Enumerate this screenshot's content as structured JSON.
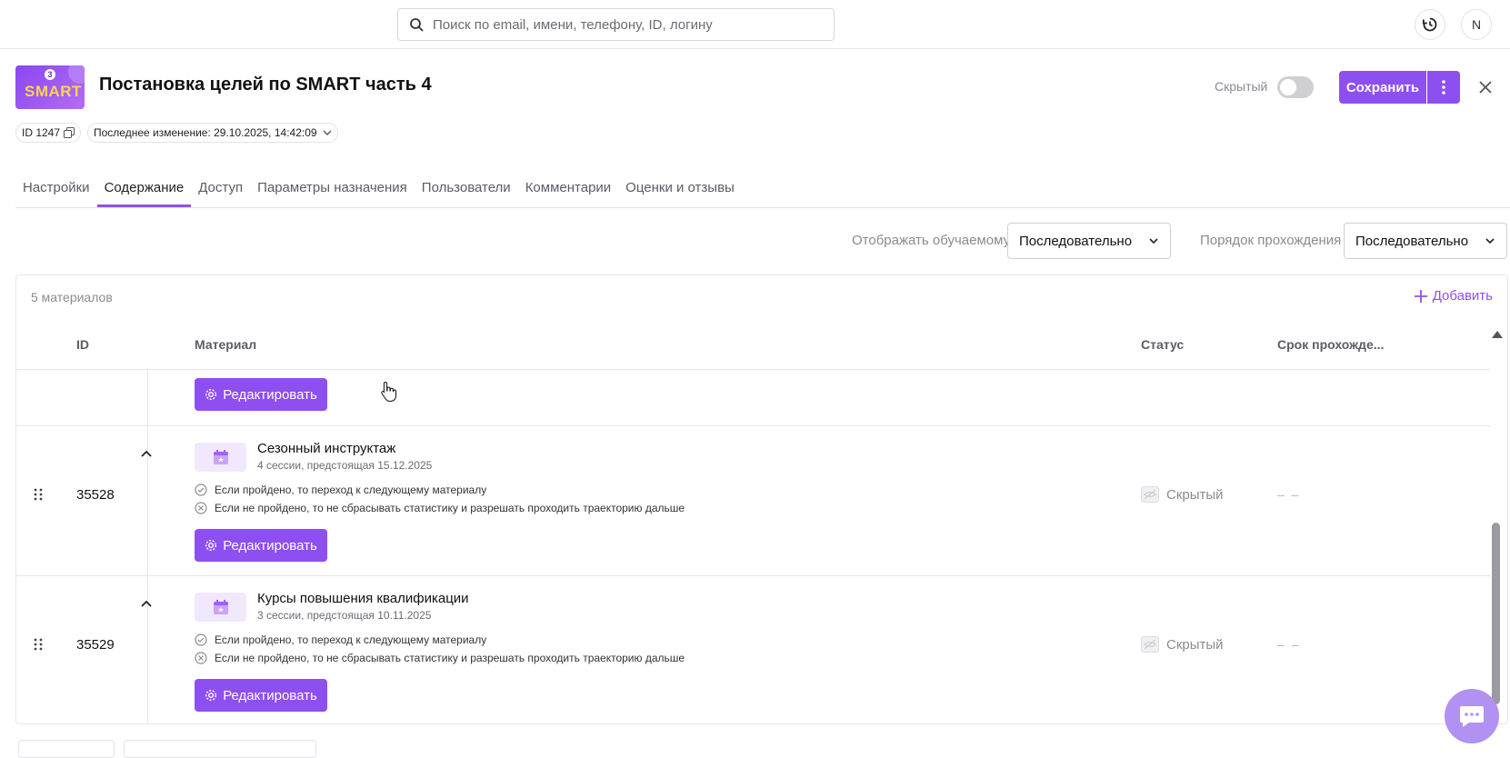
{
  "topbar": {
    "search_placeholder": "Поиск по email, имени, телефону, ID, логину",
    "avatar_initial": "N"
  },
  "header": {
    "logo_text": "SMART",
    "logo_badge": "3",
    "title": "Постановка целей по SMART часть 4",
    "hidden_label": "Скрытый",
    "save_label": "Сохранить",
    "id_chip": "ID 1247",
    "last_change": "Последнее изменение: 29.10.2025, 14:42:09"
  },
  "tabs": [
    {
      "label": "Настройки"
    },
    {
      "label": "Содержание"
    },
    {
      "label": "Доступ"
    },
    {
      "label": "Параметры назначения"
    },
    {
      "label": "Пользователи"
    },
    {
      "label": "Комментарии"
    },
    {
      "label": "Оценки и отзывы"
    }
  ],
  "filters": {
    "display_label": "Отображать обучаемому",
    "display_value": "Последовательно",
    "order_label": "Порядок прохождения",
    "order_value": "Последовательно"
  },
  "materials": {
    "count": "5 материалов",
    "add_label": "Добавить",
    "columns": {
      "id": "ID",
      "material": "Материал",
      "status": "Статус",
      "deadline": "Срок прохожде..."
    },
    "edit_label": "Редактировать",
    "rows": [
      {
        "id": "35528",
        "name": "Сезонный инструктаж",
        "sub": "4 сессии, предстоящая 15.12.2025",
        "rule_pass": "Если пройдено, то переход к следующему материалу",
        "rule_fail": "Если не пройдено, то не сбрасывать статистику и разрешать проходить траекторию дальше",
        "status": "Скрытый",
        "deadline": "– –"
      },
      {
        "id": "35529",
        "name": "Курсы повышения квалификации",
        "sub": "3 сессии, предстоящая 10.11.2025",
        "rule_pass": "Если пройдено, то переход к следующему материалу",
        "rule_fail": "Если не пройдено, то не сбрасывать статистику и разрешать проходить траекторию дальше",
        "status": "Скрытый",
        "deadline": "– –"
      }
    ]
  },
  "colors": {
    "accent": "#8e4ff0",
    "accent_light": "#f1e8fd"
  }
}
